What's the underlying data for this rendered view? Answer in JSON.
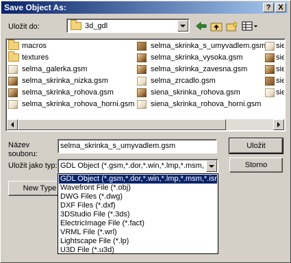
{
  "window": {
    "title": "Save Object As:",
    "help_label": "?",
    "close_label": "X"
  },
  "location": {
    "label": "Uložit do:",
    "current_folder": "3d_gdl"
  },
  "files": {
    "columns": [
      [
        {
          "name": "macros",
          "icon": "folder-icon"
        },
        {
          "name": "textures",
          "icon": "folder-icon"
        },
        {
          "name": "selma_galerka.gsm",
          "icon": "gsm-file-icon"
        },
        {
          "name": "selma_skrinka_nizka.gsm",
          "icon": "gsm-file-icon"
        },
        {
          "name": "selma_skrinka_rohova.gsm",
          "icon": "gsm-file-icon"
        },
        {
          "name": "selma_skrinka_rohova_horni.gsm",
          "icon": "gsm-file-icon"
        }
      ],
      [
        {
          "name": "selma_skrinka_s_umyvadlem.gsm",
          "icon": "gsm-file-icon"
        },
        {
          "name": "selma_skrinka_vysoka.gsm",
          "icon": "gsm-file-icon"
        },
        {
          "name": "selma_skrinka_zavesna.gsm",
          "icon": "gsm-file-icon"
        },
        {
          "name": "selma_zrcadlo.gsm",
          "icon": "gsm-file-icon"
        },
        {
          "name": "siena_skrinka_rohova.gsm",
          "icon": "gsm-file-icon"
        },
        {
          "name": "siena_skrinka_rohova_horni.gsm",
          "icon": "gsm-file-icon"
        }
      ],
      [
        {
          "name": "sie",
          "icon": "gsm-file-icon"
        },
        {
          "name": "sie",
          "icon": "gsm-file-icon"
        },
        {
          "name": "sie",
          "icon": "gsm-file-icon"
        },
        {
          "name": "sie",
          "icon": "gsm-file-icon"
        },
        {
          "name": "sie",
          "icon": "gsm-file-icon"
        }
      ]
    ]
  },
  "filename": {
    "label_line1": "Název",
    "label_line2": "souboru:",
    "value": "selma_skrinka_s_umyvadlem.gsm"
  },
  "filetype": {
    "label": "Uložit jako typ:",
    "selected": "GDL Object (*.gsm,*.dor,*.win,*.lmp,*.msm,*.ism,*"
  },
  "buttons": {
    "save": "Uložit",
    "cancel": "Storno",
    "new_type": "New Type"
  },
  "type_options": [
    "GDL Object (*.gsm,*.dor,*.win,*.lmp,*.msm,*.ism,*",
    "Wavefront File (*.obj)",
    "DWG Files (*.dwg)",
    "DXF Files (*.dxf)",
    "3DStudio File (*.3ds)",
    "ElectricImage File (*.fact)",
    "VRML File (*.wrl)",
    "Lightscape File (*.lp)",
    "U3D File (*.u3d)"
  ]
}
